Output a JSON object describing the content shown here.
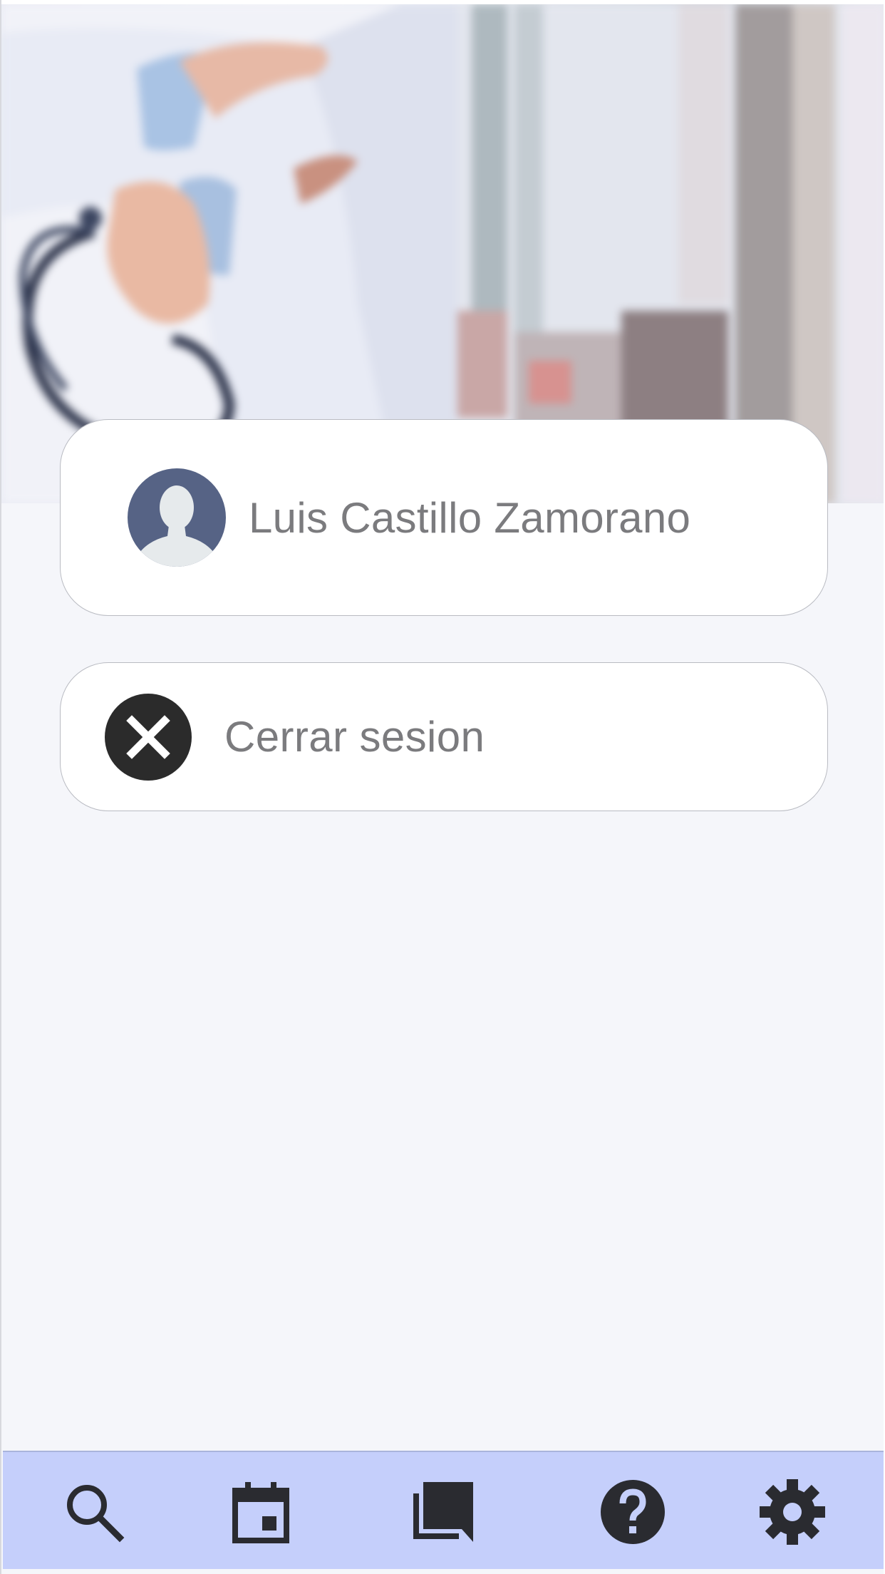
{
  "hero": {
    "image": "doctor-with-stethoscope-photo"
  },
  "profile": {
    "name": "Luis Castillo Zamorano",
    "avatar_icon": "user-silhouette-icon"
  },
  "logout": {
    "label": "Cerrar sesion",
    "icon": "close-circle-icon"
  },
  "bottom_nav": {
    "items": [
      {
        "icon": "search-icon"
      },
      {
        "icon": "calendar-icon"
      },
      {
        "icon": "chat-bubbles-icon"
      },
      {
        "icon": "help-icon"
      },
      {
        "icon": "gear-icon"
      }
    ]
  },
  "colors": {
    "page_background": "#f5f6fa",
    "card_background": "#ffffff",
    "card_border": "#b9bbc2",
    "text": "#7b7b7e",
    "avatar_background": "#566385",
    "close_icon_background": "#2b2b2b",
    "nav_background": "#c5cffb",
    "nav_icon": "#2a2b30"
  }
}
